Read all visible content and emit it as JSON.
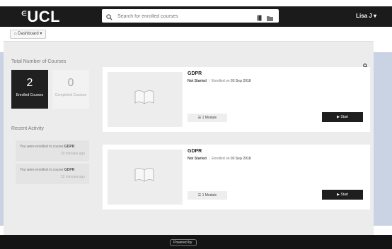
{
  "brand": {
    "logo_text": "UCL",
    "logo_mark": "∈"
  },
  "header": {
    "search_placeholder": "Search for enrolled courses",
    "user_label": "Lisa J ▾"
  },
  "subbar": {
    "dashboard_label": "Dashboard ▾"
  },
  "stats": {
    "title": "Total Number of Courses",
    "enrolled": {
      "value": "2",
      "label": "Enrolled Courses"
    },
    "completed": {
      "value": "0",
      "label": "Completed Courses"
    }
  },
  "activity": {
    "title": "Recent Activity",
    "items": [
      {
        "prefix": "You were enrolled in course ",
        "course": "GDPR",
        "ago": "20 minutes ago"
      },
      {
        "prefix": "You were enrolled in course ",
        "course": "GDPR",
        "ago": "32 minutes ago"
      }
    ]
  },
  "courses": [
    {
      "title": "GDPR",
      "status": "Not Started",
      "enrolled_prefix": "Enrolled on ",
      "enrolled_date": "03 Sep 2018",
      "modules": "1 Module",
      "start_label": "Start"
    },
    {
      "title": "GDPR",
      "status": "Not Started",
      "enrolled_prefix": "Enrolled on ",
      "enrolled_date": "03 Sep 2018",
      "modules": "1 Module",
      "start_label": "Start"
    }
  ],
  "footer": {
    "powered_by": "Powered by"
  },
  "colors": {
    "topbar": "#1b1b1b",
    "accent_dark": "#1e1e1e",
    "background": "#ececec"
  }
}
